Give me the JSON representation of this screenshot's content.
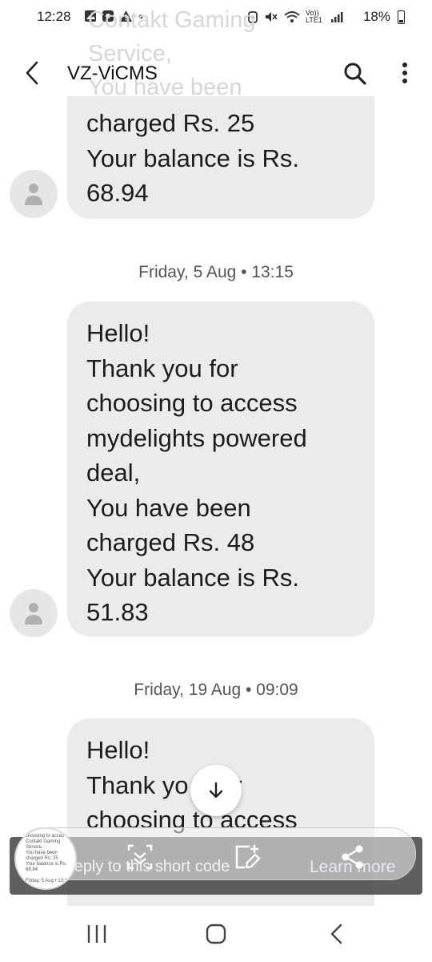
{
  "status_bar": {
    "time": "12:28",
    "network": "Vo)) LTE1",
    "battery": "18%"
  },
  "app_bar": {
    "title": "VZ-ViCMS"
  },
  "ghost_text": "Contakt Gaming\nService,\nYou have been",
  "messages": [
    {
      "text": "charged Rs. 25\nYour balance is Rs.\n68.94"
    },
    {
      "date": "Friday, 5 Aug • 13:15",
      "text": "Hello!\nThank you for\nchoosing to access\nmydelights powered\ndeal,\nYou have been\ncharged Rs. 48\nYour balance is Rs.\n51.83"
    },
    {
      "date": "Friday, 19 Aug • 09:09",
      "text": "Hello!\nThank yo   or\nchoosing to access"
    }
  ],
  "reply": {
    "placeholder": "reply to this short code",
    "learn_more": "Learn more"
  },
  "thumbnail_text": "choosing to acces\nContakt Gaming\nService,\nYou have been\ncharged Rs. 25\nYour balance is Rs.\n68.94\n\nFriday, 5 Aug • 13:15\n\nHello!",
  "icons": [
    "back-icon",
    "search-icon",
    "more-vert-icon",
    "person-icon",
    "arrow-down-icon",
    "scroll-capture-icon",
    "edit-screenshot-icon",
    "share-icon",
    "recents-icon",
    "home-icon",
    "nav-back-icon"
  ],
  "colors": {
    "bubble": "#ebebeb",
    "background": "#ffffff",
    "date_text": "#555555"
  }
}
